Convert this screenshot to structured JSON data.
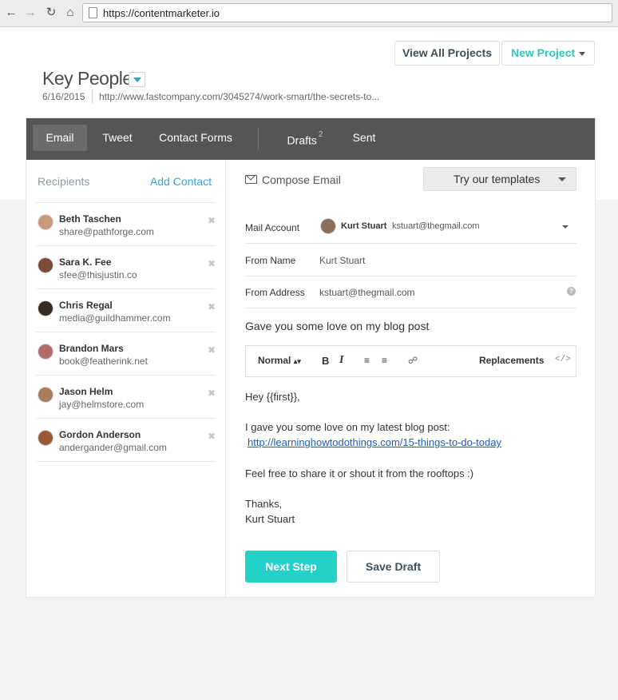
{
  "browser": {
    "url": "https://contentmarketer.io",
    "back_icon": "arrow-left-icon",
    "forward_icon": "arrow-right-icon",
    "reload_icon": "reload-icon",
    "home_icon": "home-icon"
  },
  "header": {
    "view_all_label": "View All Projects",
    "new_project_label": "New Project",
    "project_title": "Key People",
    "project_date": "6/16/2015",
    "project_url": "http://www.fastcompany.com/3045274/work-smart/the-secrets-to..."
  },
  "tabs": [
    {
      "label": "Email",
      "active": true
    },
    {
      "label": "Tweet"
    },
    {
      "label": "Contact Forms"
    },
    {
      "label": "Drafts",
      "count": "2"
    },
    {
      "label": "Sent"
    }
  ],
  "recipients": {
    "label": "Recipients",
    "add_label": "Add Contact",
    "items": [
      {
        "name": "Beth Taschen",
        "email": "share@pathforge.com",
        "avatar_color": "#c99a7a"
      },
      {
        "name": "Sara K. Fee",
        "email": "sfee@thisjustin.co",
        "avatar_color": "#7a4a3a"
      },
      {
        "name": "Chris Regal",
        "email": "media@guildhammer.com",
        "avatar_color": "#3a2a24"
      },
      {
        "name": "Brandon Mars",
        "email": "book@featherink.net",
        "avatar_color": "#b56a6a"
      },
      {
        "name": "Jason Helm",
        "email": "jay@helmstore.com",
        "avatar_color": "#a97c5e"
      },
      {
        "name": "Gordon Anderson",
        "email": "andergander@gmail.com",
        "avatar_color": "#9a5a3a"
      }
    ]
  },
  "compose": {
    "label": "Compose Email",
    "templates_label": "Try our templates",
    "mail_account_label": "Mail Account",
    "account_name": "Kurt Stuart",
    "account_email": "kstuart@thegmail.com",
    "from_name_label": "From Name",
    "from_name": "Kurt Stuart",
    "from_address_label": "From Address",
    "from_address": "kstuart@thegmail.com",
    "subject": "Gave you some love on my blog post",
    "toolbar": {
      "format": "Normal",
      "bold": "B",
      "italic": "I",
      "replacements": "Replacements",
      "code": "</>"
    },
    "body": {
      "greeting": "Hey {{first}},",
      "line1": "I gave you some love on my latest blog post:",
      "link": "http://learninghowtodothings.com/15-things-to-do-today",
      "line2": "Feel free to share it or shout it from the rooftops :)",
      "signoff": "Thanks,",
      "signature": "Kurt Stuart"
    },
    "next_label": "Next Step",
    "save_label": "Save Draft"
  },
  "colors": {
    "accent": "#23d1c9",
    "link": "#38a6d8",
    "tabbar": "#555555"
  }
}
